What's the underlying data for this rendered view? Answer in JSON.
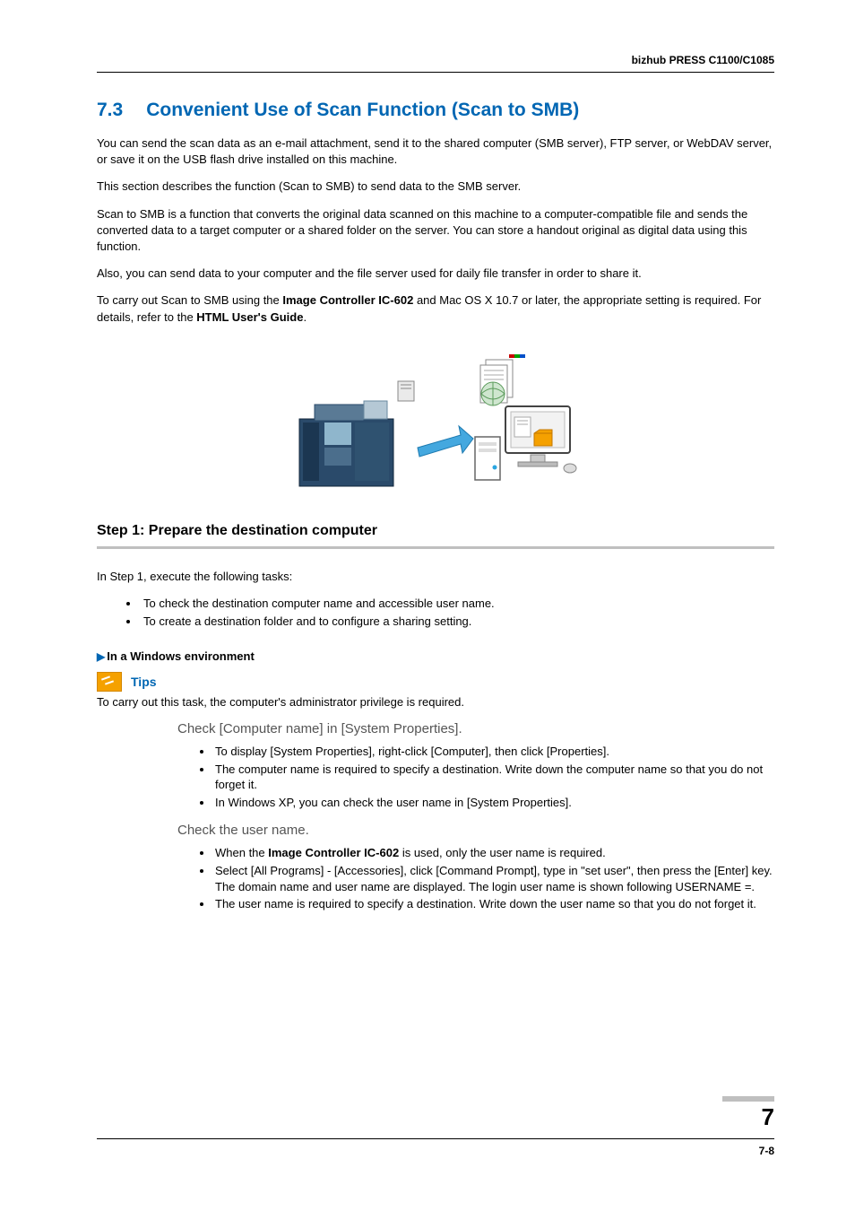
{
  "header": {
    "product": "bizhub PRESS C1100/C1085"
  },
  "section": {
    "number": "7.3",
    "title": "Convenient Use of Scan Function (Scan to SMB)"
  },
  "paragraphs": {
    "p1": "You can send the scan data as an e-mail attachment, send it to the shared computer (SMB server), FTP server, or WebDAV server, or save it on the USB flash drive installed on this machine.",
    "p2": "This section describes the function (Scan to SMB) to send data to the SMB server.",
    "p3": "Scan to SMB is a function that converts the original data scanned on this machine to a computer-compatible file and sends the converted data to a target computer or a shared folder on the server. You can store a handout original as digital data using this function.",
    "p4": "Also, you can send data to your computer and the file server used for daily file transfer in order to share it.",
    "p5_pre": "To carry out Scan to SMB using the ",
    "p5_bold1": "Image Controller IC-602",
    "p5_mid": " and Mac OS X 10.7 or later, the appropriate setting is required. For details, refer to the ",
    "p5_bold2": "HTML User's Guide",
    "p5_end": "."
  },
  "step": {
    "title": "Step 1: Prepare the destination computer",
    "intro": "In Step 1, execute the following tasks:",
    "tasks": [
      "To check the destination computer name and accessible user name.",
      "To create a destination folder and to configure a sharing setting."
    ]
  },
  "windows": {
    "heading": "In a Windows environment",
    "tips_label": "Tips",
    "tips_text": "To carry out this task, the computer's administrator privilege is required.",
    "check1": {
      "title": "Check [Computer name] in [System Properties].",
      "bullets": [
        "To display [System Properties], right-click [Computer], then click [Properties].",
        "The computer name is required to specify a destination. Write down the computer name so that you do not forget it.",
        "In Windows XP, you can check the user name in [System Properties]."
      ]
    },
    "check2": {
      "title": "Check the user name.",
      "b1_pre": "When the ",
      "b1_bold": "Image Controller IC-602",
      "b1_post": " is used, only the user name is required.",
      "b2": "Select [All Programs] - [Accessories], click [Command Prompt], type in \"set user\", then press the [Enter] key. The domain name and user name are displayed. The login user name is shown following USERNAME =.",
      "b3": "The user name is required to specify a destination. Write down the user name so that you do not forget it."
    }
  },
  "footer": {
    "chapter": "7",
    "page": "7-8"
  }
}
